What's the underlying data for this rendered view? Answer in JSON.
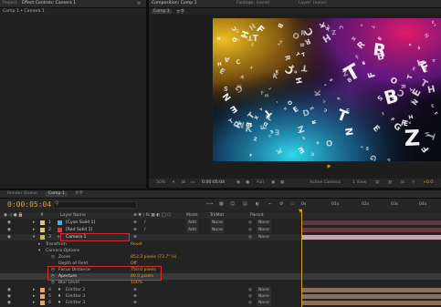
{
  "left_panel": {
    "tabs": [
      "Project",
      "Effect Controls: Camera 1"
    ],
    "breadcrumb": "Comp 1 • Camera 1"
  },
  "composition": {
    "tabs": [
      "Composition: Comp 1",
      "Footage: (none)",
      "Layer: (none)"
    ],
    "breadcrumb": "Comp 1",
    "chinese_label": "文字",
    "toolbar": {
      "zoom": "50%",
      "timecode": "0:00:05:04",
      "resolution": "Full",
      "camera": "Active Camera",
      "view": "1 View",
      "exposure": "+0.0"
    },
    "art_letters": [
      "T",
      "H",
      "E",
      "R",
      "F",
      "G",
      "B",
      "S",
      "O",
      "T",
      "E",
      "C",
      "Z",
      "R",
      "E",
      "F",
      "C",
      "D",
      "E",
      "H",
      "K",
      "T",
      "A",
      "N",
      "X"
    ]
  },
  "timeline": {
    "tabs": [
      "Render Queue",
      "Comp 1",
      "文字"
    ],
    "timecode": "0:00:05:04",
    "search_icon": "search-icon",
    "columns": {
      "num": "#",
      "name": "Layer Name",
      "switches": "",
      "mode": "Mode",
      "trkmat": "TrkMat",
      "parent": "Parent"
    },
    "ruler": [
      "0s",
      "01s",
      "02s",
      "03s",
      "04s",
      "05s"
    ],
    "layers": [
      {
        "num": "1",
        "name": "[Cyan Solid 1]",
        "mode": "Add",
        "parent": "None",
        "color": "#3fb5d8"
      },
      {
        "num": "2",
        "name": "[Red Solid 1]",
        "mode": "Add",
        "parent": "None",
        "color": "#d83a3a"
      },
      {
        "num": "3",
        "name": "Camera 1",
        "mode": "",
        "parent": "None",
        "color": "#c8b878"
      }
    ],
    "properties": [
      {
        "name": "Transform",
        "value": "Reset"
      },
      {
        "name": "Camera Options",
        "value": ""
      },
      {
        "name": "Zoom",
        "value": "853.3 pixels (73.7° H)"
      },
      {
        "name": "Depth of Field",
        "value": "Off"
      },
      {
        "name": "Focus Distance",
        "value": "750.0 pixels"
      },
      {
        "name": "Aperture",
        "value": "40.0 pixels"
      },
      {
        "name": "Blur Level",
        "value": "100%"
      }
    ],
    "emitters": [
      {
        "num": "4",
        "name": "Emitter 2",
        "parent": "None"
      },
      {
        "num": "5",
        "name": "Emitter 3",
        "parent": "None"
      },
      {
        "num": "6",
        "name": "Emitter 3",
        "parent": "None"
      }
    ]
  }
}
